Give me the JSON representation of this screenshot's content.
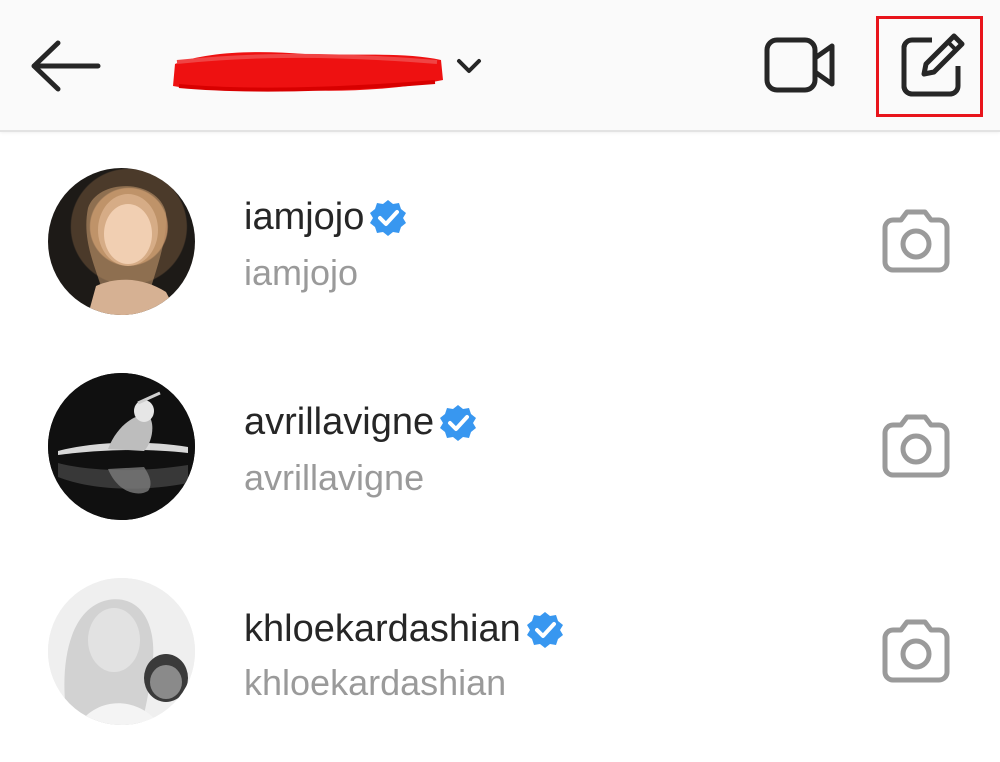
{
  "header": {
    "account_title": "",
    "back_icon": "arrow-left-icon",
    "dropdown_icon": "chevron-down-icon",
    "video_icon": "video-camera-icon",
    "compose_icon": "new-message-icon",
    "highlight_color": "#e8141b"
  },
  "conversations": [
    {
      "name": "iamjojo",
      "subtitle": "iamjojo",
      "verified": true
    },
    {
      "name": "avrillavigne",
      "subtitle": "avrillavigne",
      "verified": true
    },
    {
      "name": "khloekardashian",
      "subtitle": "khloekardashian",
      "verified": true
    }
  ],
  "colors": {
    "verified_badge": "#3897f0",
    "primary_text": "#262626",
    "secondary_text": "#9a9a9a",
    "redaction": "#ee1111"
  }
}
